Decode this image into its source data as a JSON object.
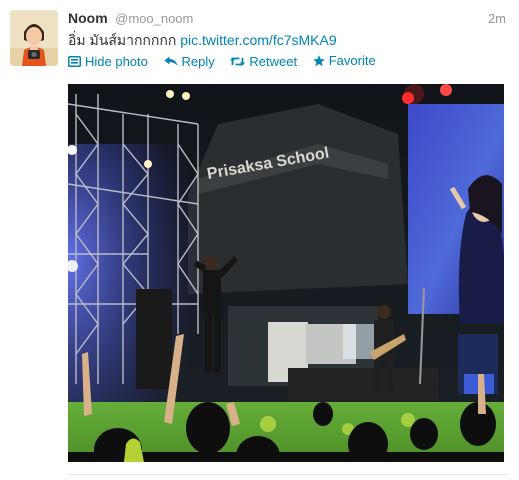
{
  "tweet": {
    "fullname": "Noom",
    "username": "@moo_noom",
    "time": "2m",
    "text": "อิ่ม มันส์มากกกกก ",
    "link": "pic.twitter.com/fc7sMKA9",
    "actions": {
      "hide_photo": "Hide photo",
      "reply": "Reply",
      "retweet": "Retweet",
      "favorite": "Favorite"
    },
    "photo": {
      "banner_text": "Prisaksa School"
    }
  },
  "colors": {
    "link": "#0084b4",
    "muted": "#999999",
    "text": "#333333"
  },
  "icons": [
    "photo-icon",
    "reply-icon",
    "retweet-icon",
    "favorite-icon"
  ]
}
